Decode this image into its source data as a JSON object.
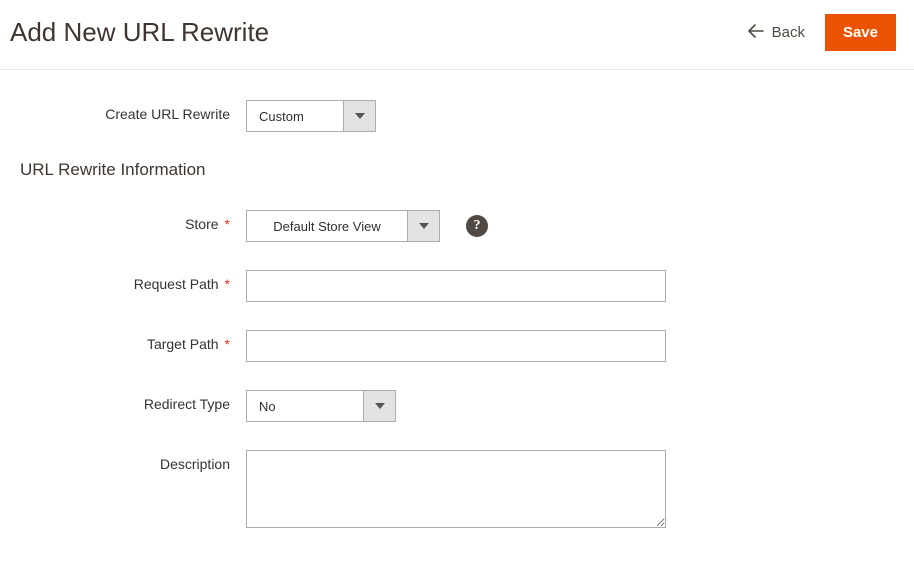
{
  "header": {
    "title": "Add New URL Rewrite",
    "back_label": "Back",
    "save_label": "Save"
  },
  "form": {
    "create_url_rewrite": {
      "label": "Create URL Rewrite",
      "value": "Custom"
    },
    "section_title": "URL Rewrite Information",
    "store": {
      "label": "Store",
      "value": "Default Store View",
      "help": "?"
    },
    "request_path": {
      "label": "Request Path",
      "value": ""
    },
    "target_path": {
      "label": "Target Path",
      "value": ""
    },
    "redirect_type": {
      "label": "Redirect Type",
      "value": "No"
    },
    "description": {
      "label": "Description",
      "value": ""
    }
  }
}
